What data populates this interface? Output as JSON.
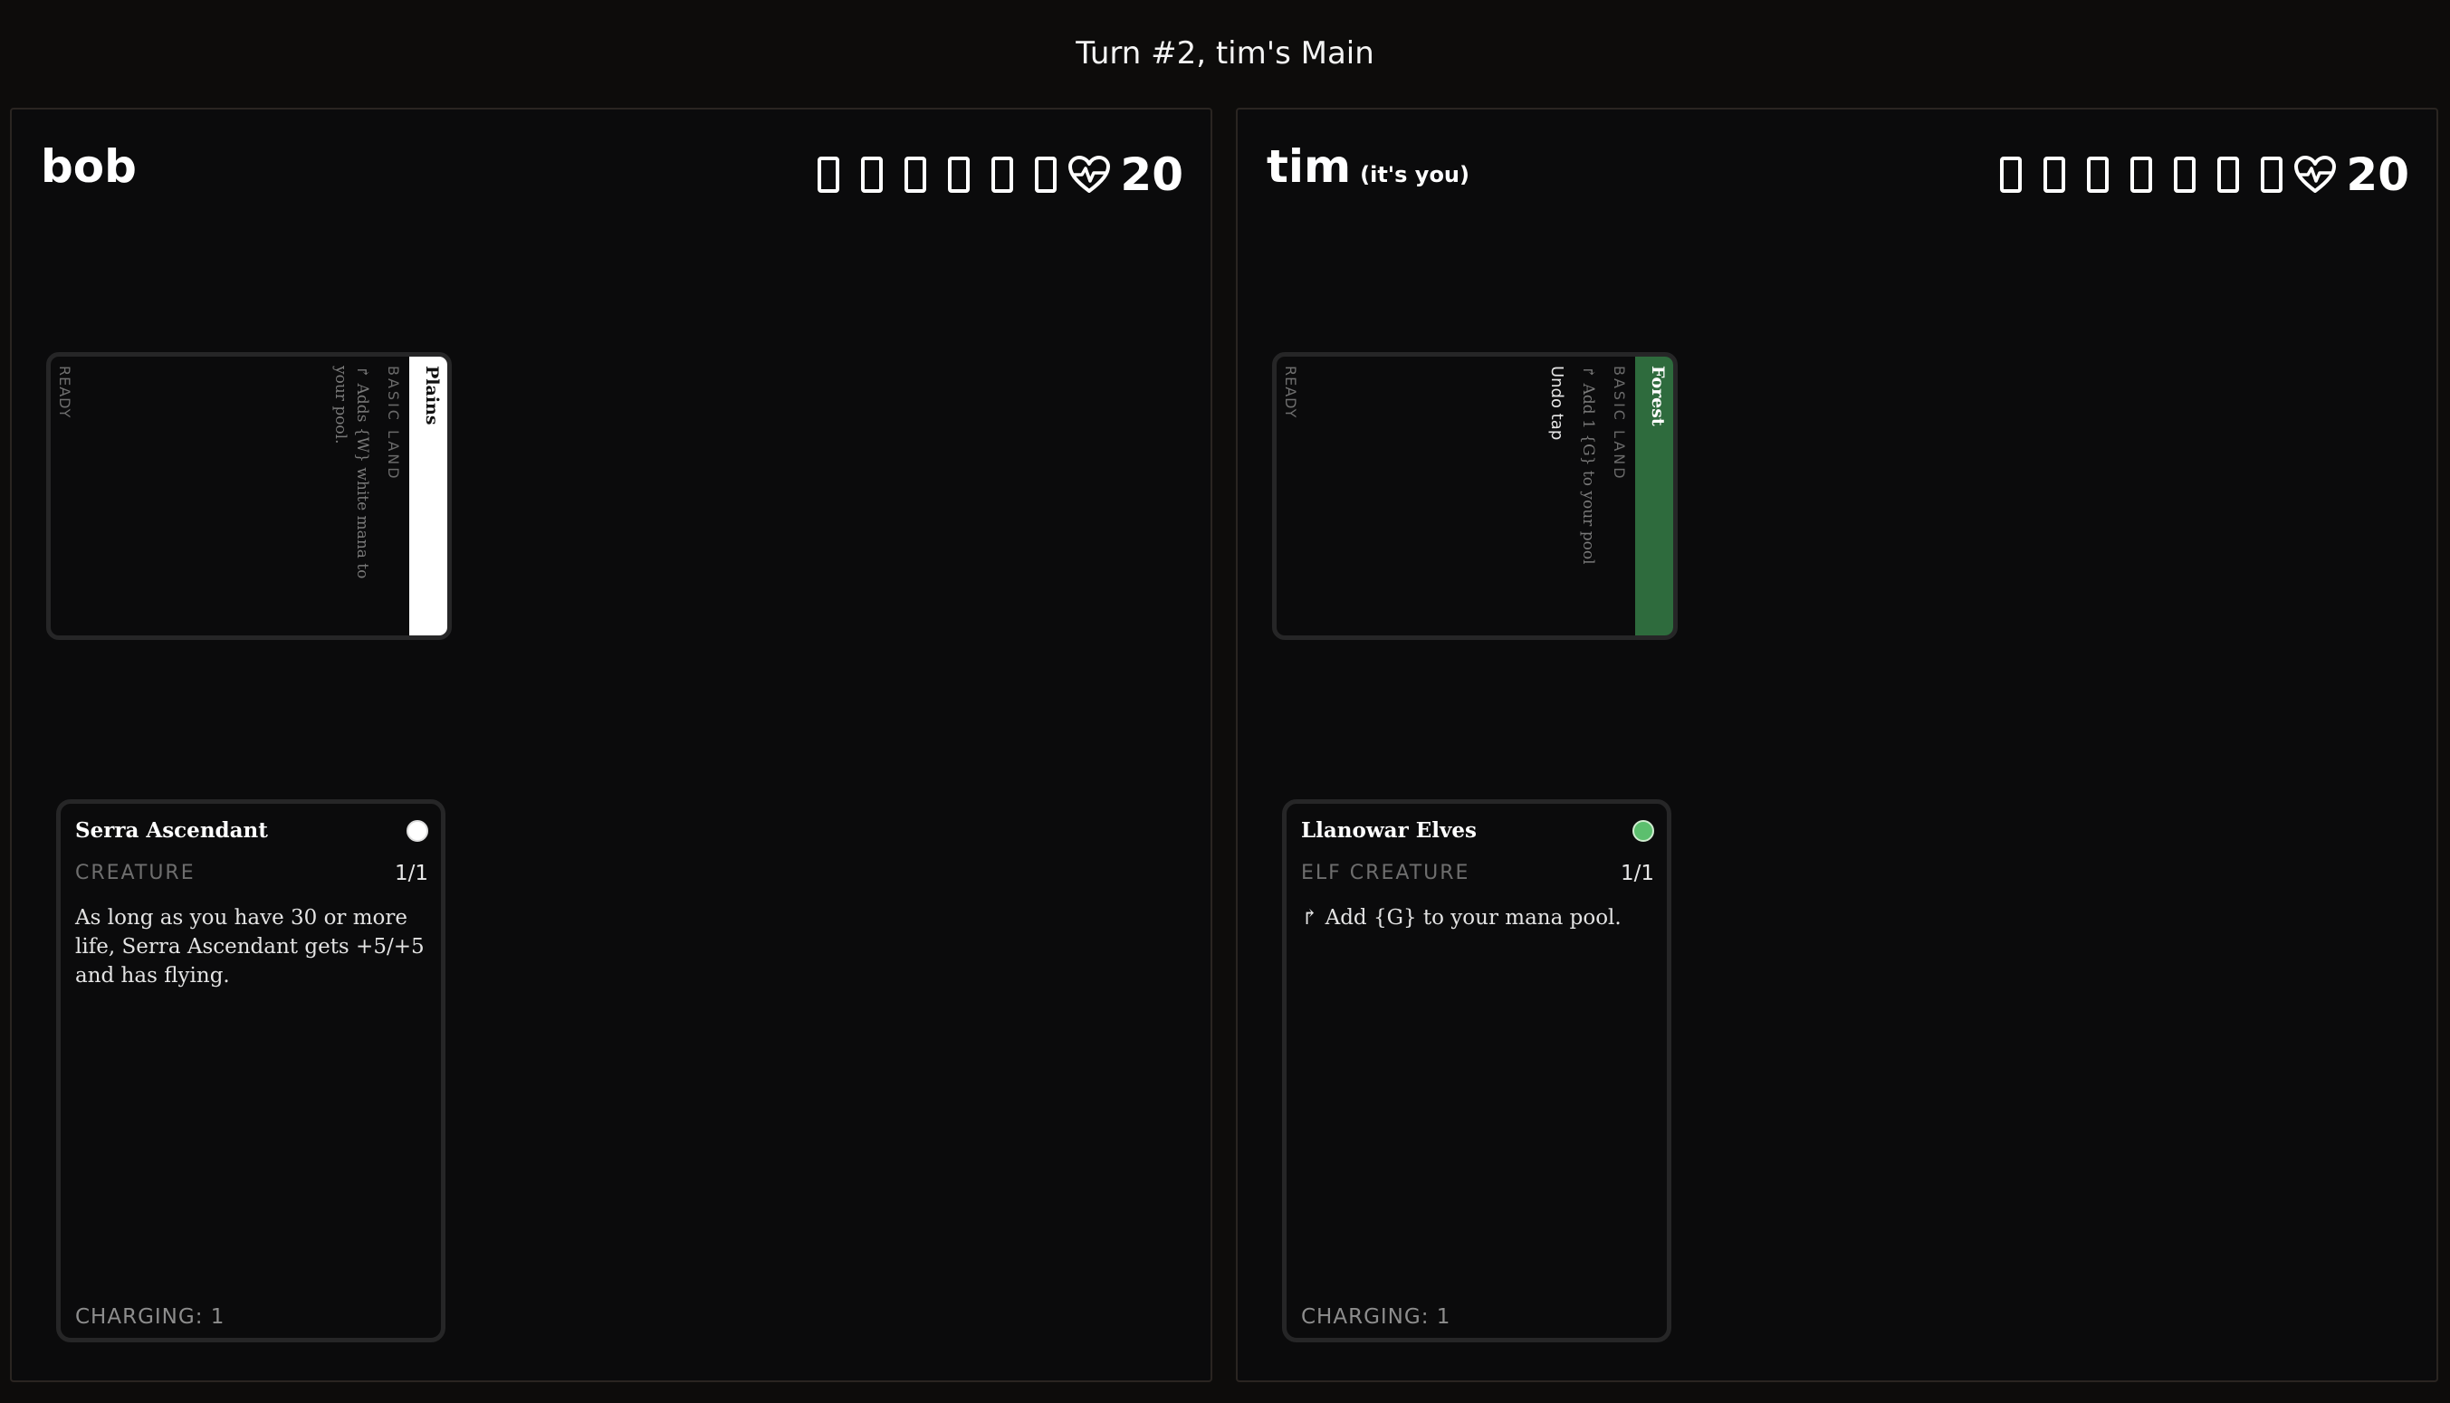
{
  "header": {
    "turn_label": "Turn #2, tim's Main"
  },
  "players": [
    {
      "name": "bob",
      "you_label": "",
      "mana_slots": 6,
      "life": "20",
      "land": {
        "name": "Plains",
        "type": "BASIC LAND",
        "ability": "↱ Adds {W} white mana to your pool.",
        "undo": "",
        "status": "READY",
        "stripe_color": "#ffffff"
      },
      "creature": {
        "name": "Serra Ascendant",
        "type": "CREATURE",
        "pt": "1/1",
        "text": "As long as you have 30 or more life, Serra Ascendant gets +5/+5 and has flying.",
        "status": "CHARGING: 1",
        "color_dot": "#ffffff"
      }
    },
    {
      "name": "tim",
      "you_label": "(it's you)",
      "mana_slots": 7,
      "life": "20",
      "land": {
        "name": "Forest",
        "type": "BASIC LAND",
        "ability": "↱ Add 1 {G} to your pool",
        "undo": "Undo tap",
        "status": "READY",
        "stripe_color": "#2e6b3d"
      },
      "creature": {
        "name": "Llanowar Elves",
        "type": "ELF  CREATURE",
        "pt": "1/1",
        "text": "↱ Add {G} to your mana pool.",
        "status": "CHARGING: 1",
        "color_dot": "#5cbf6e"
      }
    }
  ]
}
